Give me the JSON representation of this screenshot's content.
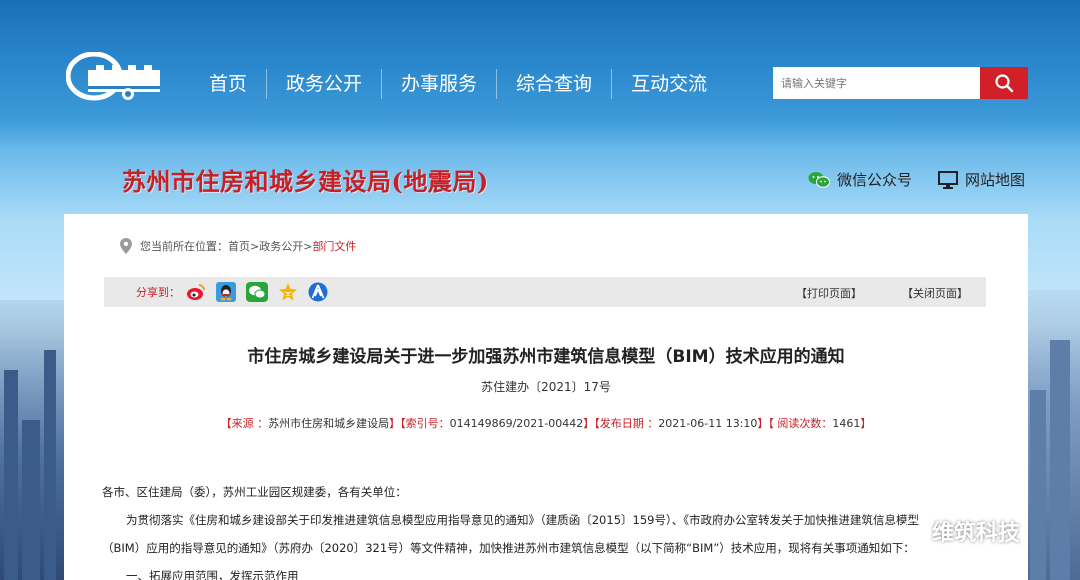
{
  "nav": {
    "items": [
      "首页",
      "政务公开",
      "办事服务",
      "综合查询",
      "互动交流"
    ]
  },
  "search": {
    "placeholder": "请输入关键字"
  },
  "site": {
    "title": "苏州市住房和城乡建设局(地震局)"
  },
  "top_links": {
    "wechat": "微信公众号",
    "sitemap": "网站地图"
  },
  "breadcrumb": {
    "prefix": "您当前所在位置：",
    "items": [
      "首页",
      "政务公开",
      "部门文件"
    ],
    "sep": ">"
  },
  "share": {
    "label": "分享到：",
    "icons": [
      "weibo-icon",
      "qq-icon",
      "wechat-icon",
      "qzone-icon",
      "renren-icon"
    ],
    "print": "【打印页面】",
    "close": "【关闭页面】"
  },
  "doc": {
    "title": "市住房城乡建设局关于进一步加强苏州市建筑信息模型（BIM）技术应用的通知",
    "number": "苏住建办〔2021〕17号",
    "meta": {
      "source_label": "【来源 ：",
      "source": "苏州市住房和城乡建设局",
      "index_label": "】【索引号：",
      "index": "014149869/2021-00442",
      "date_label": "】【发布日期 ：",
      "date": "2021-06-11 13:10",
      "views_label": "】【 阅读次数：",
      "views": "1461",
      "end": "】"
    },
    "paragraphs": [
      "各市、区住建局（委），苏州工业园区规建委，各有关单位：",
      "为贯彻落实《住房和城乡建设部关于印发推进建筑信息模型应用指导意见的通知》（建质函〔2015〕159号）、《市政府办公室转发关于加快推进建筑信息模型",
      "（BIM）应用的指导意见的通知》（苏府办〔2020〕321号）等文件精神，加快推进苏州市建筑信息模型（以下简称“BIM”）技术应用，现将有关事项通知如下：",
      "一、拓展应用范围，发挥示范作用"
    ]
  },
  "watermark": {
    "text": "维筑科技"
  },
  "colors": {
    "brand_red": "#c81f25",
    "search_red": "#d2202a"
  }
}
